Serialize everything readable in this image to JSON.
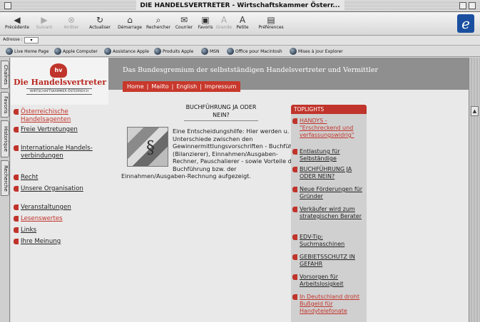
{
  "window": {
    "title": "DIE HANDELSVERTRETER - Wirtschaftskammer Österr..."
  },
  "toolbar": {
    "buttons": [
      {
        "label": "Précédente",
        "icon": "back-arrow-icon",
        "glyph": "◀"
      },
      {
        "label": "Suivant",
        "icon": "forward-arrow-icon",
        "glyph": "▶"
      },
      {
        "label": "Arrêter",
        "icon": "stop-icon",
        "glyph": "⊗"
      },
      {
        "label": "Actualiser",
        "icon": "refresh-icon",
        "glyph": "↻"
      },
      {
        "label": "Démarrage",
        "icon": "home-icon",
        "glyph": "⌂"
      },
      {
        "label": "Rechercher",
        "icon": "search-icon",
        "glyph": "⌕"
      },
      {
        "label": "Courrier",
        "icon": "mail-icon",
        "glyph": "✉"
      },
      {
        "label": "Favoris",
        "icon": "favorites-icon",
        "glyph": "▣"
      },
      {
        "label": "Grande",
        "icon": "font-larger-icon",
        "glyph": "A"
      },
      {
        "label": "Petite",
        "icon": "font-smaller-icon",
        "glyph": "A"
      },
      {
        "label": "Préférences",
        "icon": "preferences-icon",
        "glyph": "▤"
      }
    ]
  },
  "address": {
    "label": "Adresse :",
    "value": ""
  },
  "links_bar": [
    "Live Home Page",
    "Apple Computer",
    "Assistance Apple",
    "Produits Apple",
    "MSN",
    "Office pour Macintosh",
    "Mises à jour Explorer"
  ],
  "side_tabs": [
    "Chaînes",
    "Favoris",
    "Historique",
    "Recherche"
  ],
  "site": {
    "logo_title": "Die Handelsvertreter",
    "logo_subtitle": "WIRTSCHAFTSKAMMER ÖSTERREICH",
    "banner": "Das Bundesgremium der selbstständigen Handelsvertreter und Vermittler",
    "nav": [
      "Home",
      "Mailto",
      "English",
      "Impressum"
    ]
  },
  "left_nav": [
    {
      "label": "Österreichische Handelsagenten",
      "active": true
    },
    {
      "label": "Freie Vertretungen",
      "active": false
    },
    {
      "label": "Internationale Handels-verbindungen",
      "active": false
    },
    {
      "label": "Recht",
      "active": false
    },
    {
      "label": "Unsere Organisation",
      "active": false
    },
    {
      "label": "Veranstaltungen",
      "active": false
    },
    {
      "label": "Lesenswertes",
      "active": true
    },
    {
      "label": "Links",
      "active": false
    },
    {
      "label": "Ihre Meinung",
      "active": false
    }
  ],
  "article": {
    "heading": "BUCHFÜHRUNG JA ODER NEIN?",
    "body": "Eine Entscheidungshilfe: Hier werden u. a. Unterschiede zwischen den Gewinnermittlungsvorschriften - Buchführer (Bilanzierer), Einnahmen/Ausgaben-Rechner, Pauschalierer - sowie Vorteile der Buchführung bzw. der Einnahmen/Ausgaben-Rechnung aufgezeigt."
  },
  "toplights": {
    "heading": "TOPLIGHTS",
    "items": [
      {
        "label": "HANDYS - \"Erschreckend und verfassungswidrig\"",
        "active": true
      },
      {
        "label": "Entlastung für Selbständige",
        "active": false
      },
      {
        "label": "BUCHFÜHRUNG JA ODER NEIN?",
        "active": false
      },
      {
        "label": "Neue Förderungen für Gründer",
        "active": false
      },
      {
        "label": "Verkäufer wird zum strategischen Berater",
        "active": false
      },
      {
        "label": "EDV-Tip: Suchmaschinen",
        "active": false
      },
      {
        "label": "GEBIETSSCHUTZ IN GEFAHR",
        "active": false
      },
      {
        "label": "Vorsorgen für Arbeitslosigkeit",
        "active": false
      },
      {
        "label": "In Deutschland droht Bußgeld für Handytelefonate",
        "active": true
      }
    ]
  }
}
